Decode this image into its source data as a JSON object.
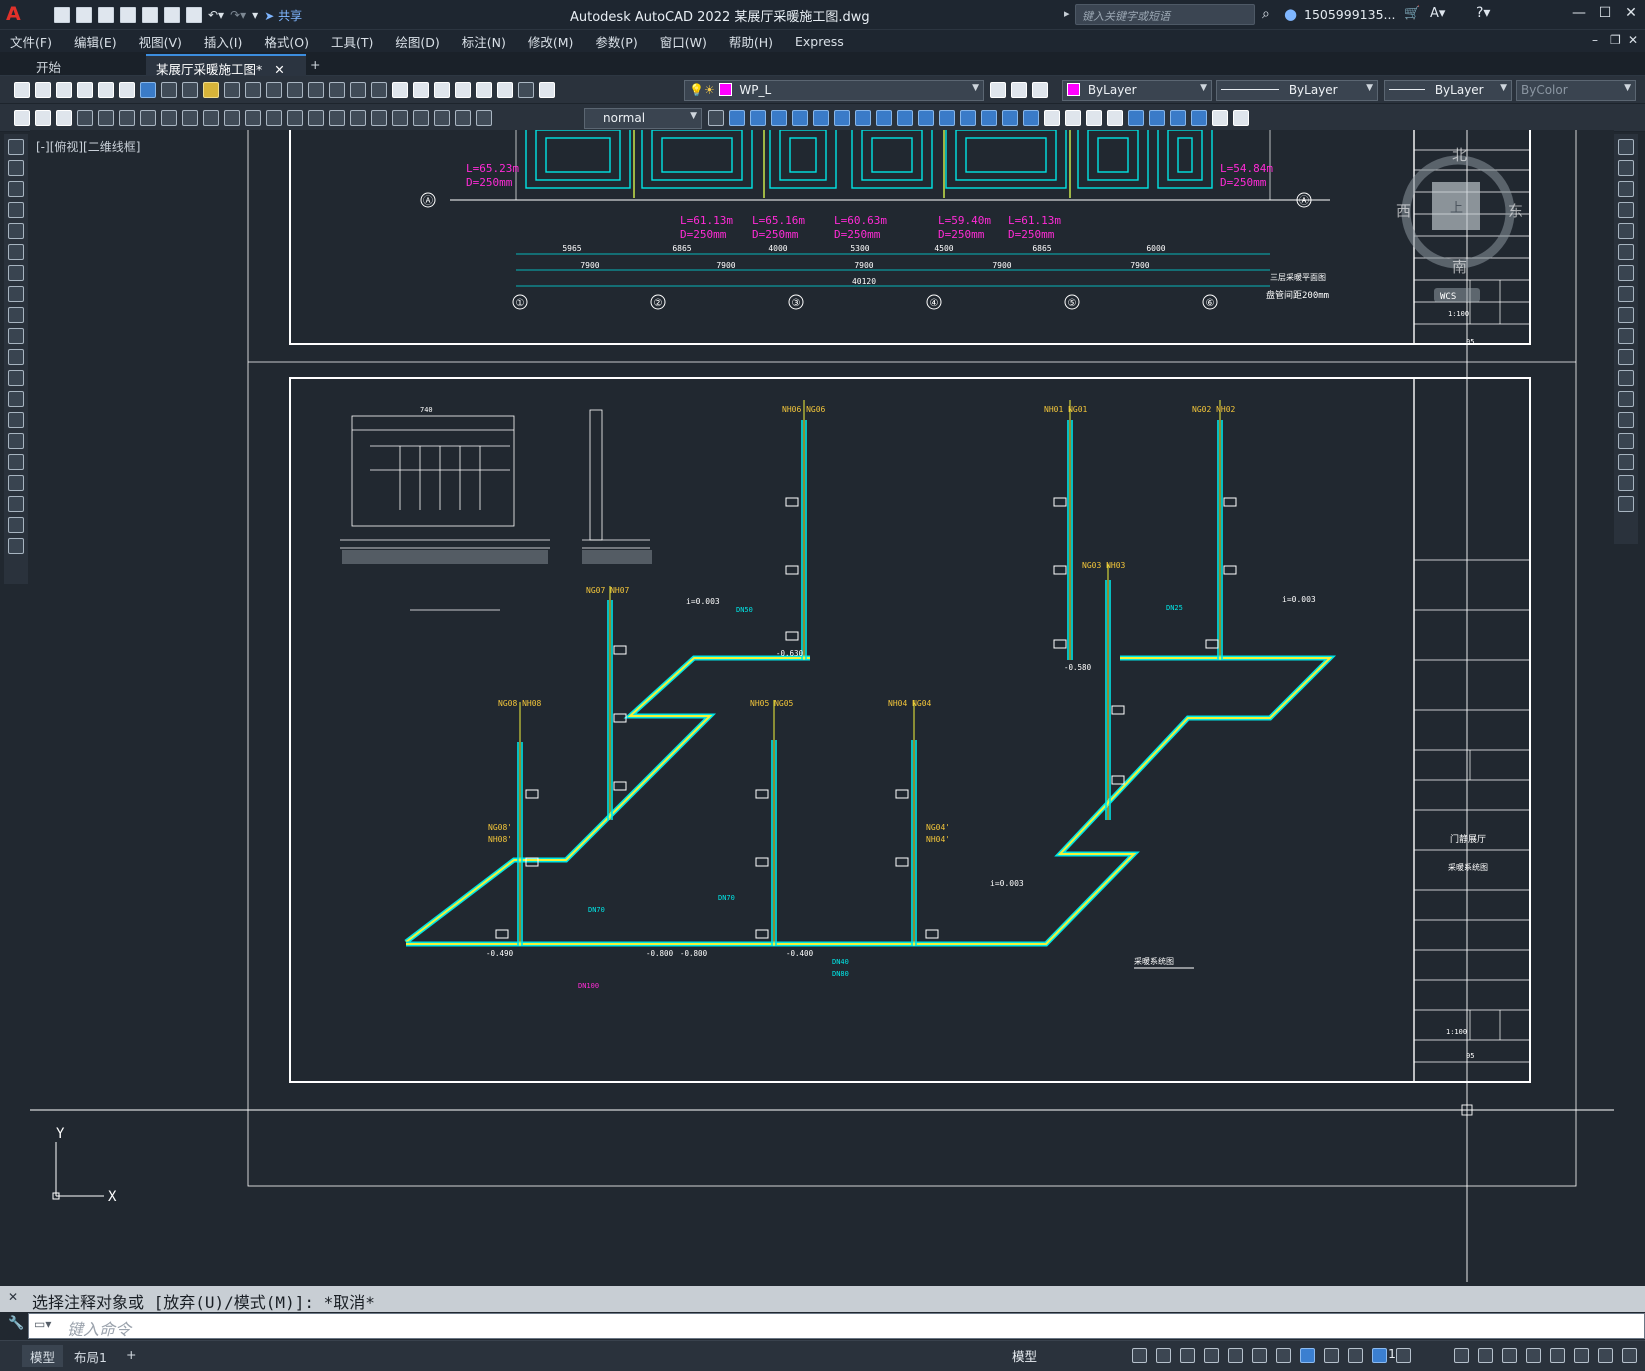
{
  "app": {
    "title": "Autodesk AutoCAD 2022    某展厅采暖施工图.dwg",
    "logo": "A",
    "share_label": "共享",
    "search_placeholder": "键入关键字或短语",
    "user": "1505999135...",
    "accent_color": "#e0312a"
  },
  "menu": [
    "文件(F)",
    "编辑(E)",
    "视图(V)",
    "插入(I)",
    "格式(O)",
    "工具(T)",
    "绘图(D)",
    "标注(N)",
    "修改(M)",
    "参数(P)",
    "窗口(W)",
    "帮助(H)",
    "Express"
  ],
  "tabs": {
    "start": "开始",
    "drawing": "某展厅采暖施工图*",
    "close": "✕",
    "add": "+"
  },
  "toolbar": {
    "layer": "WP_L",
    "color": "ByLayer",
    "linetype": "ByLayer",
    "lineweight": "ByLayer",
    "plotstyle": "ByColor",
    "textstyle": "normal",
    "layer_color": "#ff00ff"
  },
  "viewport_label": "[-][俯视][二维线框]",
  "viewcube": {
    "north": "北",
    "south": "南",
    "east": "东",
    "west": "西",
    "top": "上",
    "wcs": "WCS"
  },
  "drawing": {
    "plan_title": "三层采暖平面图",
    "plan_note": "盘管间距200mm",
    "system_title": "采暖系统图",
    "grid_axes": [
      "①",
      "②",
      "③",
      "④",
      "⑤",
      "⑥"
    ],
    "grid_row": "Ⓐ",
    "dims_top": [
      "5965",
      "6865",
      "4000",
      "5300",
      "4500",
      "6865",
      "6000"
    ],
    "dims_mid": [
      "7900",
      "7900",
      "7900",
      "7900",
      "7900"
    ],
    "dims_total": "40120",
    "loop_labels": [
      {
        "l": "L=65.23m",
        "d": "D=250mm"
      },
      {
        "l": "L=54.84m",
        "d": "D=250mm"
      },
      {
        "l": "L=61.13m",
        "d": "D=250mm"
      },
      {
        "l": "L=65.16m",
        "d": "D=250mm"
      },
      {
        "l": "L=60.63m",
        "d": "D=250mm"
      },
      {
        "l": "L=59.40m",
        "d": "D=250mm"
      },
      {
        "l": "L=61.13m",
        "d": "D=250mm"
      }
    ],
    "riser_tags": [
      "NH06 NG06",
      "NG07 NH07",
      "NG08 NH08",
      "NH05 NG05",
      "NH04 NG04",
      "NH01 NG01",
      "NG02 NH02",
      "NG03 NH03",
      "NG08'",
      "NH08'",
      "NG04'",
      "NH04'"
    ],
    "slopes": [
      "i=0.003",
      "i=0.003",
      "i=0.003"
    ],
    "elevations": [
      "-0.630",
      "-0.580",
      "-0.490",
      "-0.800",
      "-0.800",
      "-0.400"
    ],
    "pipes": [
      "DN50",
      "DN70",
      "DN70",
      "DN25",
      "DN80",
      "DN40",
      "DN100"
    ],
    "detail_dim": "740",
    "title_block_scale": "1:100",
    "title_block_sheet": "05",
    "title_block_project": "门静展厅",
    "title_block_name": "采暖系统图"
  },
  "ucs": {
    "x": "X",
    "y": "Y"
  },
  "command": {
    "history": "选择注释对象或 [放弃(U)/模式(M)]: *取消*",
    "placeholder": "键入命令"
  },
  "status": {
    "model_tab": "模型",
    "layout_tab": "布局1",
    "add": "+",
    "model_label": "模型",
    "scale": "1:1"
  }
}
